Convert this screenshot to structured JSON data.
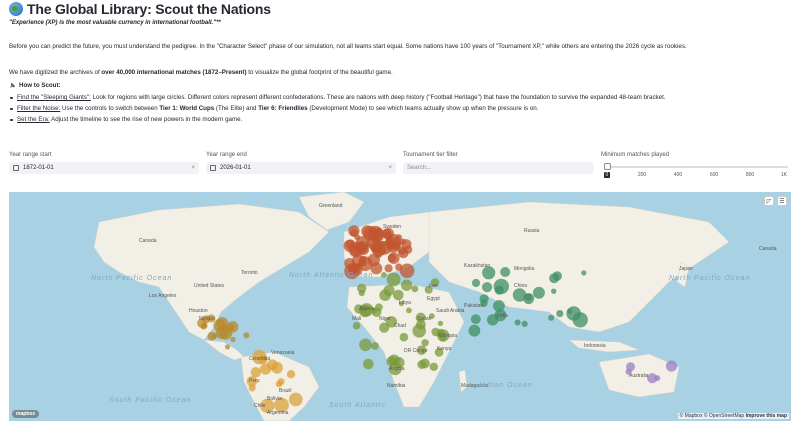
{
  "header": {
    "title": "The Global Library: Scout the Nations",
    "globe_icon": "globe-icon"
  },
  "quote": "\"Experience (XP) is the most valuable currency in international football.\"**",
  "intro": "Before you can predict the future, you must understand the pedigree. In the \"Character Select\" phase of our simulation, not all teams start equal. Some nations have 100 years of \"Tournament XP,\" while others are entering the 2026 cycle as rookies.",
  "archive": {
    "pre": "We have digitized the archives of ",
    "bold": "over 40,000 international matches (1872–Present)",
    "post": " to visualize the global footprint of the beautiful game."
  },
  "howto": {
    "label": "How to Scout:",
    "icon": "pin-icon"
  },
  "bullets": {
    "b1_link": "Find the \"Sleeping Giants\":",
    "b1_text": " Look for regions with large circles. Different colors represent different confederations. These are nations with deep history (\"Football Heritage\") that have the foundation to survive the expanded 48-team bracket.",
    "b2_link": "Filter the Noise:",
    "b2_a": " Use the controls to switch between ",
    "b2_t1": "Tier 1: World Cups",
    "b2_b": " (The Elite) and ",
    "b2_t6": "Tier 6: Friendlies",
    "b2_c": " (Development Mode) to see which teams actually show up when the pressure is on.",
    "b3_link": "Set the Era:",
    "b3_text": " Adjust the timeline to see the rise of new powers in the modern game."
  },
  "controls": {
    "start_label": "Year range start",
    "start_value": "1872-01-01",
    "end_label": "Year range end",
    "end_value": "2026-01-01",
    "tier_label": "Tournament tier filter",
    "tier_placeholder": "Search...",
    "min_label": "Minimum matches played",
    "min_value": "0",
    "slider_ticks": [
      "200",
      "400",
      "600",
      "800",
      "1K"
    ],
    "min_fraction": 0.0
  },
  "map": {
    "attribution": "© Mapbox © OpenStreetMap",
    "improve": "Improve this map",
    "logo": "mapbox",
    "ocean_color": "#a8d1e3",
    "land_color": "#f2efe6",
    "labels": {
      "greenland": "Greenland",
      "canada_w": "Canada",
      "canada_e": "Canada",
      "us": "United States",
      "mexico": "Mexico",
      "russia": "Russia",
      "kazakhstan": "Kazakhstan",
      "mongolia": "Mongolia",
      "china": "China",
      "iran": "Iran",
      "pakistan": "Pakistan",
      "algeria": "Algeria",
      "libya": "Libya",
      "egypt": "Egypt",
      "mali": "Mali",
      "niger": "Niger",
      "sudan": "Sudan",
      "chad": "Chad",
      "drc": "DR Congo",
      "brazil": "Brazil",
      "peru": "Peru",
      "bolivia": "Bolivia",
      "argentina": "Argentina",
      "australia": "Australia",
      "indonesia": "Indonesia",
      "madagascar": "Madagascar",
      "sweden": "Sweden",
      "india": "India",
      "saudi": "Saudi Arabia",
      "ethiopia": "Ethiopia",
      "kenya": "Kenya",
      "angola": "Angola",
      "namibia": "Namibia",
      "japan": "Japan",
      "colombia": "Colombia",
      "venezuela": "Venezuela",
      "chile": "Chile",
      "los_angeles": "Los Angeles",
      "houston": "Houston",
      "toronto": "Toronto"
    },
    "oceans": [
      "North Pacific Ocean",
      "North Atlantic Ocean",
      "North Pacific Ocean",
      "Indian Ocean",
      "South Pacific Ocean",
      "South Atlantic"
    ]
  }
}
